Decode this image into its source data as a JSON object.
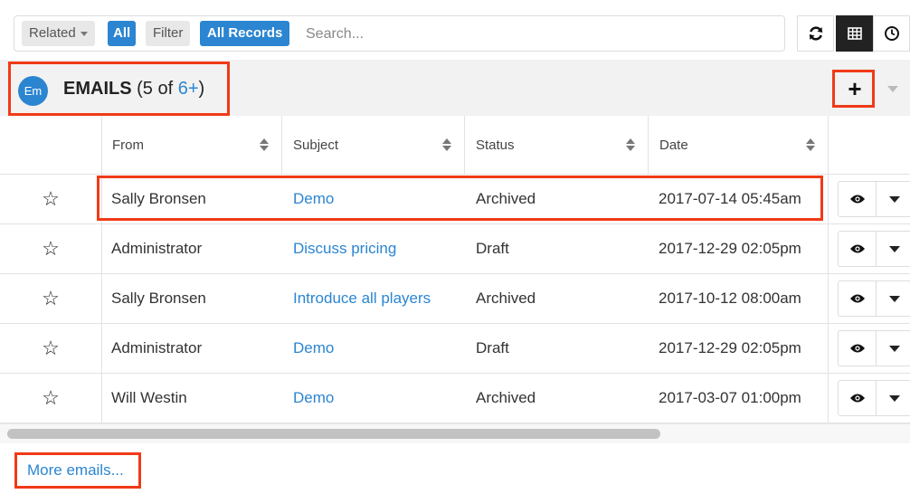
{
  "toolbar": {
    "related_label": "Related",
    "related_value": "All",
    "filter_label": "Filter",
    "filter_value": "All Records",
    "search_placeholder": "Search..."
  },
  "panel": {
    "avatar": "Em",
    "title": "EMAILS",
    "count_prefix": " (5 of ",
    "count_link": "6+",
    "count_suffix": ")",
    "add_label": "+"
  },
  "columns": [
    "From",
    "Subject",
    "Status",
    "Date"
  ],
  "rows": [
    {
      "from": "Sally Bronsen",
      "subject": "Demo",
      "status": "Archived",
      "date": "2017-07-14 05:45am"
    },
    {
      "from": "Administrator",
      "subject": "Discuss pricing",
      "status": "Draft",
      "date": "2017-12-29 02:05pm"
    },
    {
      "from": "Sally Bronsen",
      "subject": "Introduce all players",
      "status": "Archived",
      "date": "2017-10-12 08:00am"
    },
    {
      "from": "Administrator",
      "subject": "Demo",
      "status": "Draft",
      "date": "2017-12-29 02:05pm"
    },
    {
      "from": "Will Westin",
      "subject": "Demo",
      "status": "Archived",
      "date": "2017-03-07 01:00pm"
    }
  ],
  "more_link": "More emails...",
  "icons": {
    "refresh": "refresh-icon",
    "list_view": "table-view-icon",
    "activity": "clock-icon",
    "favorite": "star-outline-icon",
    "preview": "eye-icon"
  },
  "colors": {
    "accent": "#2b85d1",
    "highlight": "#f03a17",
    "header_bg": "#f2f2f2"
  }
}
